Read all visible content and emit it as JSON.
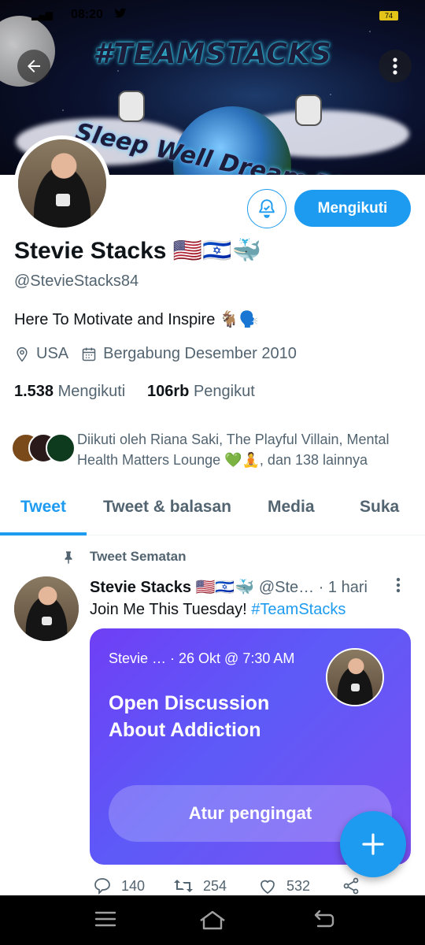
{
  "status_bar": {
    "time": "08:20",
    "battery": "74"
  },
  "banner": {
    "title": "#TEAMSTACKS",
    "subtitle": "Sleep Well Dream BIG"
  },
  "profile": {
    "name": "Stevie Stacks 🇺🇸🇮🇱🐳",
    "handle": "@StevieStacks84",
    "bio": "Here To Motivate and Inspire 🐐🗣️",
    "location": "USA",
    "joined": "Bergabung Desember 2010",
    "following_count": "1.538",
    "following_label": "Mengikuti",
    "followers_count": "106rb",
    "followers_label": "Pengikut",
    "follow_button": "Mengikuti",
    "followed_by": "Diikuti oleh Riana Saki, The Playful Villain, Mental Health Matters Lounge 💚🧘, dan 138 lainnya"
  },
  "tabs": [
    {
      "label": "Tweet",
      "active": true
    },
    {
      "label": "Tweet & balasan",
      "active": false
    },
    {
      "label": "Media",
      "active": false
    },
    {
      "label": "Suka",
      "active": false
    }
  ],
  "pinned_tweet": {
    "pin_label": "Tweet Sematan",
    "author_name": "Stevie Stacks 🇺🇸🇮🇱🐳",
    "author_handle": "@Ste…",
    "time": "· 1 hari",
    "text_prefix": "Join Me This Tuesday! ",
    "hashtag": "#TeamStacks",
    "space": {
      "meta": "Stevie … · 26 Okt @ 7:30 AM",
      "title": "Open Discussion About Addiction",
      "button": "Atur pengingat"
    },
    "replies": "140",
    "retweets": "254",
    "likes": "532"
  },
  "colors": {
    "accent": "#1d9bf0",
    "space_card": "#6f3ff5",
    "secondary_text": "#536471"
  }
}
